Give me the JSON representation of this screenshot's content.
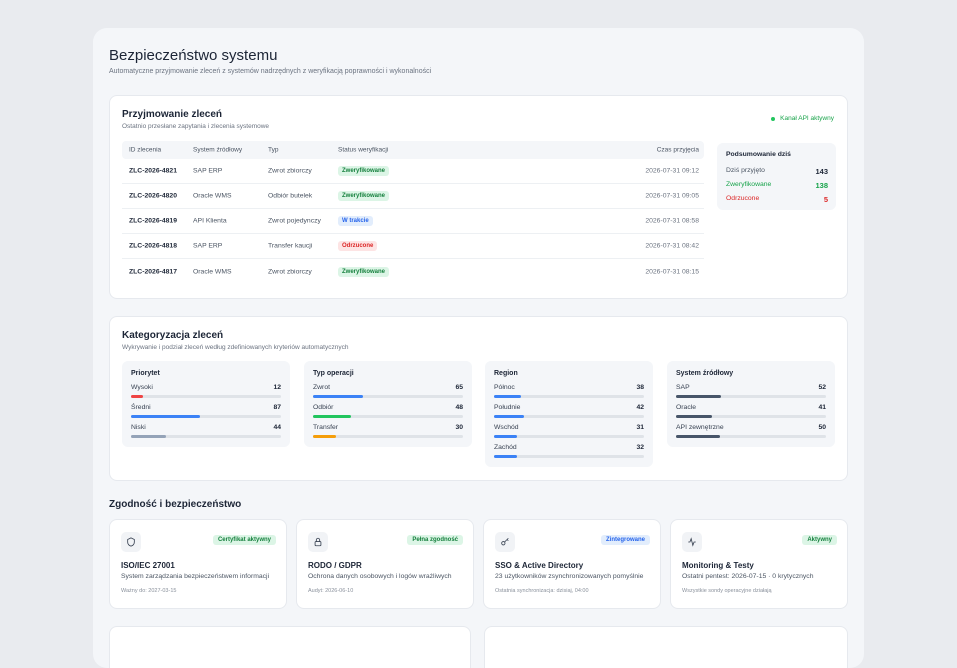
{
  "page": {
    "title": "Bezpieczeństwo systemu",
    "subtitle": "Automatyczne przyjmowanie zleceń z systemów nadrzędnych z weryfikacją poprawności i wykonalności"
  },
  "orders": {
    "title": "Przyjmowanie zleceń",
    "subtitle": "Ostatnio przesłane zapytania i zlecenia systemowe",
    "api_status": "Kanał API aktywny",
    "columns": [
      "ID zlecenia",
      "System źródłowy",
      "Typ",
      "Status weryfikacji",
      "Czas przyjęcia"
    ],
    "rows": [
      {
        "id": "ZLC-2026-4821",
        "system": "SAP ERP",
        "type": "Zwrot zbiorczy",
        "status": "Zweryfikowane",
        "time": "2026-07-31 09:12"
      },
      {
        "id": "ZLC-2026-4820",
        "system": "Oracle WMS",
        "type": "Odbiór butelek",
        "status": "Zweryfikowane",
        "time": "2026-07-31 09:05"
      },
      {
        "id": "ZLC-2026-4819",
        "system": "API Klienta",
        "type": "Zwrot pojedynczy",
        "status": "W trakcie",
        "time": "2026-07-31 08:58"
      },
      {
        "id": "ZLC-2026-4818",
        "system": "SAP ERP",
        "type": "Transfer kaucji",
        "status": "Odrzucone",
        "time": "2026-07-31 08:42"
      },
      {
        "id": "ZLC-2026-4817",
        "system": "Oracle WMS",
        "type": "Zwrot zbiorczy",
        "status": "Zweryfikowane",
        "time": "2026-07-31 08:15"
      }
    ],
    "summary": {
      "title": "Podsumowanie dziś",
      "received_label": "Dziś przyjęto",
      "received": "143",
      "verified_label": "Zweryfikowane",
      "verified": "138",
      "rejected_label": "Odrzucone",
      "rejected": "5"
    }
  },
  "categorization": {
    "title": "Kategoryzacja zleceń",
    "subtitle": "Wykrywanie i podział zleceń według zdefiniowanych kryteriów automatycznych",
    "groups": [
      {
        "title": "Priorytet",
        "items": [
          {
            "label": "Wysoki",
            "value": "12",
            "share": 0.08,
            "color": "#ef4444"
          },
          {
            "label": "Średni",
            "value": "87",
            "share": 0.46,
            "color": "#3b82f6"
          },
          {
            "label": "Niski",
            "value": "44",
            "share": 0.23,
            "color": "#94a3b8"
          }
        ]
      },
      {
        "title": "Typ operacji",
        "items": [
          {
            "label": "Zwrot",
            "value": "65",
            "share": 0.33,
            "color": "#3b82f6"
          },
          {
            "label": "Odbiór",
            "value": "48",
            "share": 0.25,
            "color": "#22c55e"
          },
          {
            "label": "Transfer",
            "value": "30",
            "share": 0.15,
            "color": "#f59e0b"
          }
        ]
      },
      {
        "title": "Region",
        "items": [
          {
            "label": "Północ",
            "value": "38",
            "share": 0.18,
            "color": "#3b82f6"
          },
          {
            "label": "Południe",
            "value": "42",
            "share": 0.2,
            "color": "#3b82f6"
          },
          {
            "label": "Wschód",
            "value": "31",
            "share": 0.15,
            "color": "#3b82f6"
          },
          {
            "label": "Zachód",
            "value": "32",
            "share": 0.15,
            "color": "#3b82f6"
          }
        ]
      },
      {
        "title": "System źródłowy",
        "items": [
          {
            "label": "SAP",
            "value": "52",
            "share": 0.3,
            "color": "#475569"
          },
          {
            "label": "Oracle",
            "value": "41",
            "share": 0.24,
            "color": "#475569"
          },
          {
            "label": "API zewnętrzne",
            "value": "50",
            "share": 0.29,
            "color": "#475569"
          }
        ]
      }
    ]
  },
  "compliance": {
    "title": "Zgodność i bezpieczeństwo",
    "cards": [
      {
        "icon": "shield-icon",
        "badge": "Certyfikat aktywny",
        "badge_color": "green",
        "title": "ISO/IEC 27001",
        "desc": "System zarządzania bezpieczeństwem informacji",
        "meta": "Ważny do: 2027-03-15"
      },
      {
        "icon": "lock-icon",
        "badge": "Pełna zgodność",
        "badge_color": "green",
        "title": "RODO / GDPR",
        "desc": "Ochrona danych osobowych i logów wrażliwych",
        "meta": "Audyt: 2026-06-10"
      },
      {
        "icon": "key-icon",
        "badge": "Zintegrowane",
        "badge_color": "blue",
        "title": "SSO & Active Directory",
        "desc": "23 użytkowników zsynchronizowanych pomyślnie",
        "meta": "Ostatnia synchronizacja: dzisiaj, 04:00"
      },
      {
        "icon": "activity-icon",
        "badge": "Aktywny",
        "badge_color": "green",
        "title": "Monitoring & Testy",
        "desc": "Ostatni pentest: 2026-07-15 · 0 krytycznych",
        "meta": "Wszystkie sondy operacyjne działają"
      }
    ]
  },
  "colors": {
    "green": "#15803d",
    "green_bg": "#dcf5e6",
    "blue": "#2563eb",
    "blue_bg": "#e2edfc",
    "red": "#dc2626"
  }
}
